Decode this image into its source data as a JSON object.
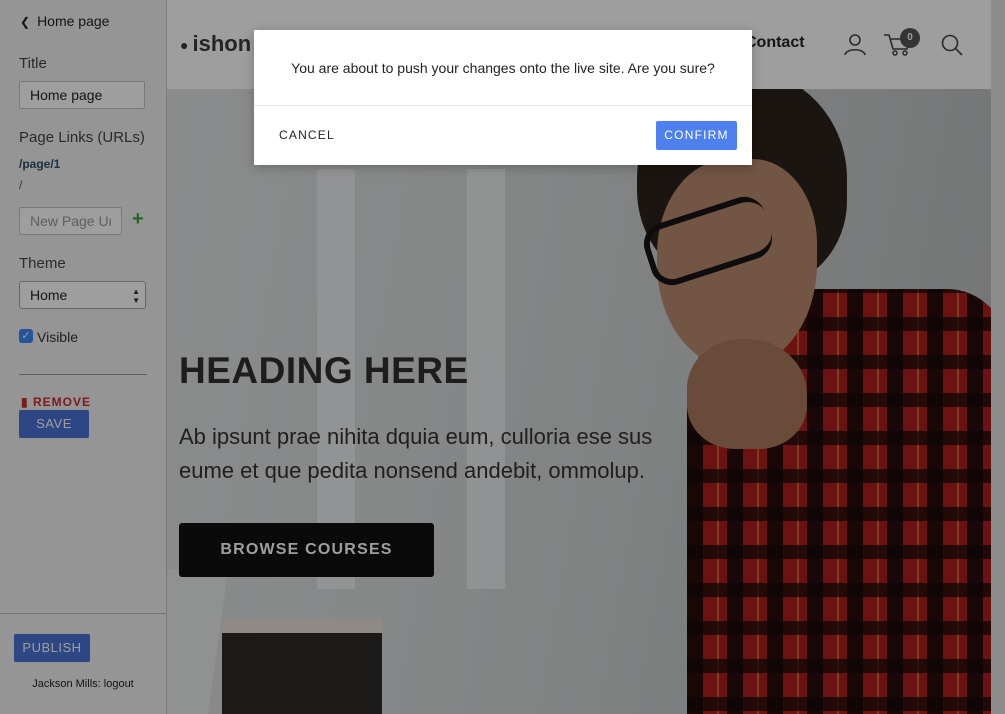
{
  "sidebar": {
    "back_label": "Home page",
    "title_label": "Title",
    "title_value": "Home page",
    "page_links_label": "Page Links (URLs)",
    "page_links": [
      "/page/1",
      "/"
    ],
    "new_url_placeholder": "New Page Url",
    "theme_label": "Theme",
    "theme_value": "Home",
    "visible_label": "Visible",
    "visible_checked": true,
    "remove_label": "REMOVE",
    "save_label": "SAVE",
    "publish_label": "PUBLISH",
    "user_name": "Jackson Mills",
    "logout_label": "logout"
  },
  "site": {
    "logo_text": "ishon",
    "nav_contact": "Contact",
    "cart_count": "0",
    "hero_heading": "HEADING HERE",
    "hero_text": "Ab ipsunt prae nihita dquia eum, culloria ese sus eume et que pedita nonsend andebit, ommolup.",
    "hero_button": "BROWSE COURSES"
  },
  "modal": {
    "message": "You are about to push your changes onto the live site. Are you sure?",
    "cancel_label": "CANCEL",
    "confirm_label": "CONFIRM"
  },
  "colors": {
    "primary_button": "#4a71d6",
    "confirm_button": "#4f80f0",
    "remove_red": "#c72c2c",
    "add_green": "#3fa243"
  }
}
